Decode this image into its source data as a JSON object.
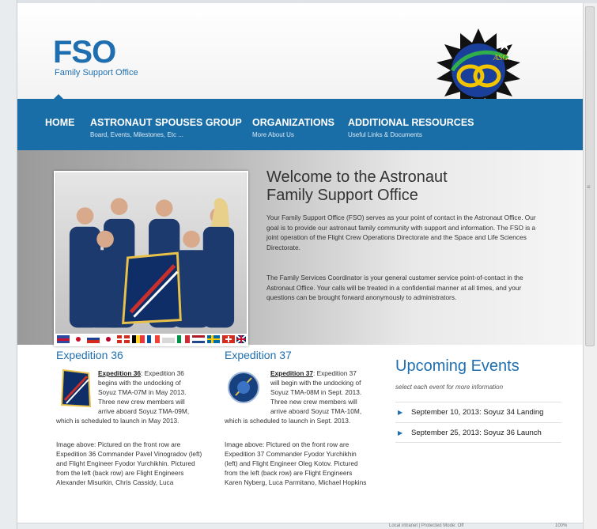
{
  "header": {
    "logo": "FSO",
    "logo_sub": "Family Support Office",
    "badge_text": "ASG"
  },
  "nav": [
    {
      "label": "HOME",
      "sub": ""
    },
    {
      "label": "ASTRONAUT SPOUSES GROUP",
      "sub": "Board, Events, Milestones, Etc ..."
    },
    {
      "label": "ORGANIZATIONS",
      "sub": "More About Us"
    },
    {
      "label": "ADDITIONAL RESOURCES",
      "sub": "Useful Links & Documents"
    }
  ],
  "welcome": {
    "title_line1": "Welcome to the Astronaut",
    "title_line2": "Family Support Office",
    "p1": "Your Family Support Office (FSO) serves as your point of contact in the Astronaut Office. Our goal is to provide our astronaut family community with support and information. The FSO is a joint operation of the Flight Crew Operations Directorate and the Space and Life Sciences Directorate.",
    "p2": "The Family Services Coordinator is your general customer service point-of-contact in the Astronaut Office. Your calls will be treated in a confidential manner at all times, and your questions can be brought forward anonymously to administrators."
  },
  "expedition36": {
    "title": "Expedition 36",
    "link": "Expedition 36",
    "intro": ": Expedition 36 begins with the undocking of Soyuz TMA-07M in May 2013. Three new crew members will arrive aboard Soyuz TMA-09M,",
    "cont": "which is scheduled to launch in May 2013.",
    "caption": "Image above: Pictured on the front row are Expedition 36 Commander Pavel Vinogradov (left) and Flight Engineer Fyodor Yurchikhin. Pictured from the left (back row) are Flight Engineers Alexander Misurkin, Chris Cassidy, Luca"
  },
  "expedition37": {
    "title": "Expedition 37",
    "link": "Expedition 37",
    "intro": ": Expedition 37 will begin with the undocking of Soyuz TMA-08M in Sept. 2013. Three new crew members will arrive aboard Soyuz TMA-10M,",
    "cont": "which is scheduled to launch in Sept. 2013.",
    "caption": "Image above: Pictured on the front row are Expedition 37 Commander Fyodor Yurchikhin (left) and Flight Engineer Oleg Kotov. Pictured from the left (back row) are Flight Engineers Karen Nyberg, Luca Parmitano, Michael Hopkins"
  },
  "events": {
    "title": "Upcoming Events",
    "hint": "select each event for more information",
    "items": [
      {
        "label": "September 10, 2013: Soyuz 34 Landing"
      },
      {
        "label": "September 25, 2013: Soyuz 36 Launch"
      }
    ]
  },
  "status": {
    "left": "Local intranet | Protected Mode: Off",
    "right": "100%"
  },
  "colors": {
    "brand_blue": "#1f6fb0",
    "nav_blue": "#1a6ea8"
  }
}
